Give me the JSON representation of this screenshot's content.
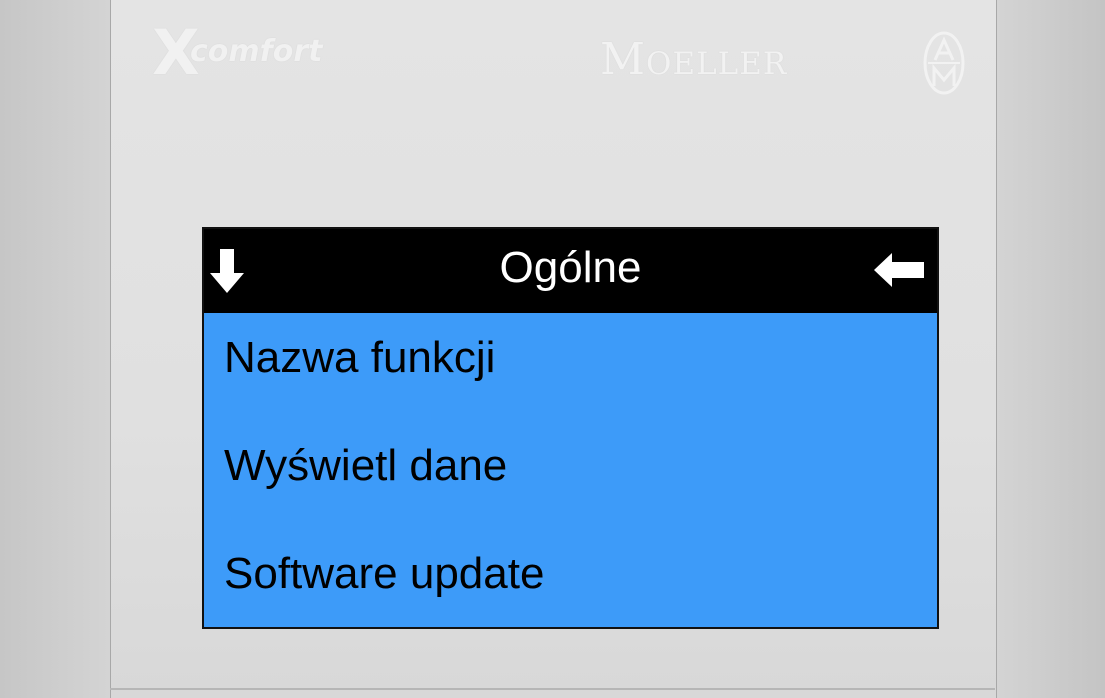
{
  "brand": {
    "x_mark": "X",
    "product": "comfort",
    "manufacturer": "Moeller",
    "seal_icon": "moeller-am-seal-icon"
  },
  "screen": {
    "title": "Ogólne",
    "left_icon": "down-arrow-icon",
    "right_icon": "back-arrow-icon",
    "background_color": "#3d9bf9",
    "title_bar_color": "#000000",
    "menu": [
      {
        "label": "Nazwa funkcji"
      },
      {
        "label": "Wyświetl dane"
      },
      {
        "label": "Software update"
      }
    ]
  }
}
